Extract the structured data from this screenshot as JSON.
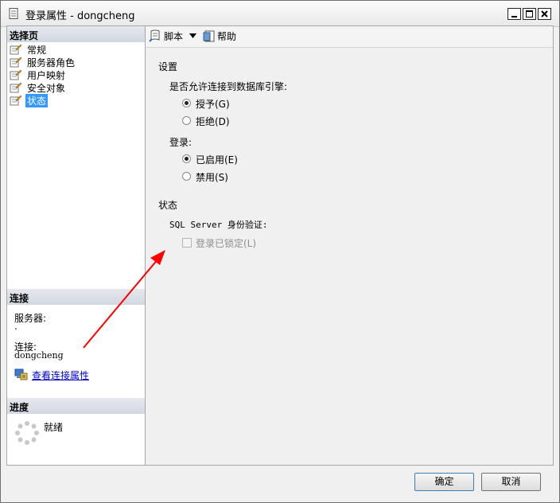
{
  "window": {
    "title": "登录属性 - dongcheng"
  },
  "left_panel": {
    "select_page_header": "选择页",
    "nav_items": [
      {
        "label": "常规",
        "icon": "page-wrench-icon"
      },
      {
        "label": "服务器角色",
        "icon": "page-wrench-icon"
      },
      {
        "label": "用户映射",
        "icon": "page-wrench-icon"
      },
      {
        "label": "安全对象",
        "icon": "page-wrench-icon"
      },
      {
        "label": "状态",
        "icon": "page-wrench-icon",
        "selected": true
      }
    ],
    "connection_header": "连接",
    "server_label": "服务器:",
    "server_value": ".",
    "connection_label": "连接:",
    "connection_value": "dongcheng",
    "view_conn_props_link": "查看连接属性",
    "progress_header": "进度",
    "progress_status": "就绪"
  },
  "toolbar": {
    "script_label": "脚本",
    "help_label": "帮助"
  },
  "content": {
    "settings_title": "设置",
    "db_engine_question": "是否允许连接到数据库引擎:",
    "grant_label": "授予(G)",
    "deny_label": "拒绝(D)",
    "db_engine_selected": "grant",
    "login_label": "登录:",
    "enabled_label": "已启用(E)",
    "disabled_label": "禁用(S)",
    "login_selected": "enabled",
    "status_title": "状态",
    "sql_auth_label": "SQL Server 身份验证:",
    "locked_label": "登录已锁定(L)",
    "locked_checked": false,
    "locked_enabled": false
  },
  "footer": {
    "ok_label": "确定",
    "cancel_label": "取消"
  },
  "colors": {
    "selection": "#3399ff",
    "link": "#0000cc",
    "annotation_arrow": "#ff0000"
  }
}
